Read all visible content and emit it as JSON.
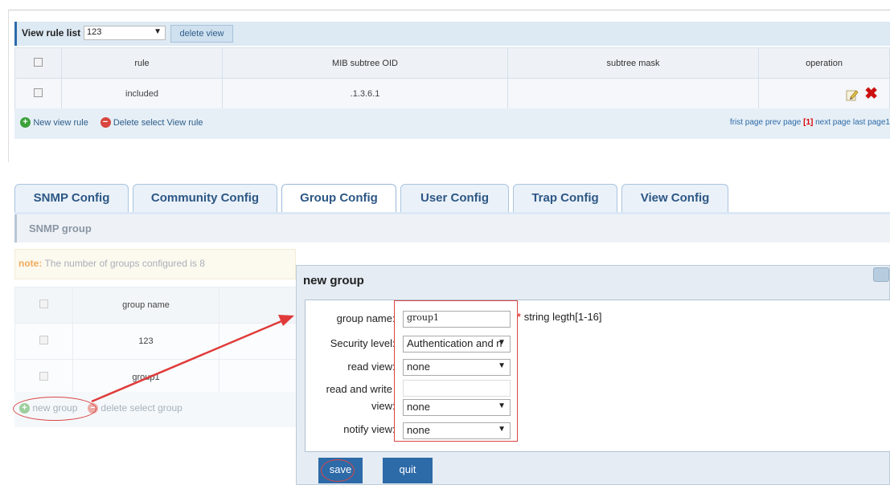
{
  "view_panel": {
    "title": "View rule list",
    "selected_view": "123",
    "delete_view_label": "delete view",
    "columns": [
      "rule",
      "MIB subtree OID",
      "subtree mask",
      "operation"
    ],
    "rows": [
      {
        "rule": "included",
        "oid": ".1.3.6.1",
        "mask": ""
      }
    ],
    "new_rule_label": "New view rule",
    "delete_rule_label": "Delete select View rule",
    "pager": {
      "first": "frist page",
      "prev": "prev page",
      "current": "[1]",
      "next": "next page",
      "last": "last page1"
    }
  },
  "tabs": [
    "SNMP Config",
    "Community Config",
    "Group Config",
    "User Config",
    "Trap Config",
    "View Config"
  ],
  "active_tab": "Group Config",
  "section_title": "SNMP group",
  "note": {
    "label": "note:",
    "text": "The number of groups configured is 8"
  },
  "group_table": {
    "header": "group name",
    "rows": [
      "123",
      "group1"
    ],
    "new_group_label": "new group",
    "delete_group_label": "delete select group"
  },
  "dialog": {
    "title": "new group",
    "fields": {
      "group_name": {
        "label": "group name",
        "value": "group1",
        "hint": "string legth[1-16]"
      },
      "security_level": {
        "label": "Security level",
        "value": "Authentication and n"
      },
      "read_view": {
        "label": "read view",
        "value": "none"
      },
      "rw_view": {
        "label_line1": "read and write",
        "label_line2": "view",
        "value": "none"
      },
      "notify_view": {
        "label": "notify view",
        "value": "none"
      }
    },
    "save_label": "save",
    "quit_label": "quit"
  },
  "colors": {
    "accent": "#2d6aa8",
    "annotation": "#d94747",
    "delete": "#cc1010",
    "add": "#3aa13a"
  }
}
